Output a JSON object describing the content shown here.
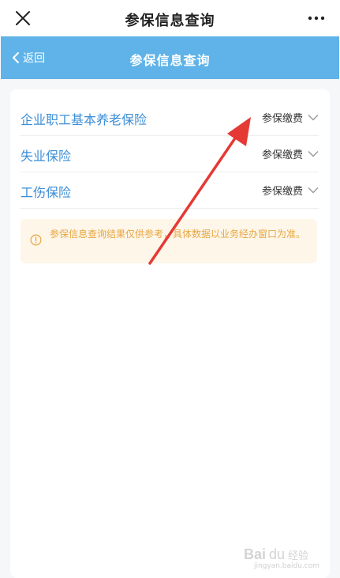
{
  "appbar": {
    "title": "参保信息查询"
  },
  "navbar": {
    "back_label": "返回",
    "title": "参保信息查询",
    "color": "#5fb3e8"
  },
  "insurance_list": [
    {
      "label": "企业职工基本养老保险",
      "value": "参保缴费"
    },
    {
      "label": "失业保险",
      "value": "参保缴费"
    },
    {
      "label": "工伤保险",
      "value": "参保缴费"
    }
  ],
  "notice": {
    "text": "参保信息查询结果仅供参考，具体数据以业务经办窗口为准。",
    "icon": "info-icon"
  },
  "colors": {
    "label_blue": "#3b8ed6",
    "notice_bg": "#fdf6e9",
    "notice_text": "#e8a640",
    "arrow_red": "#e53935"
  },
  "watermark": {
    "url": "jingyan.baidu.com"
  }
}
